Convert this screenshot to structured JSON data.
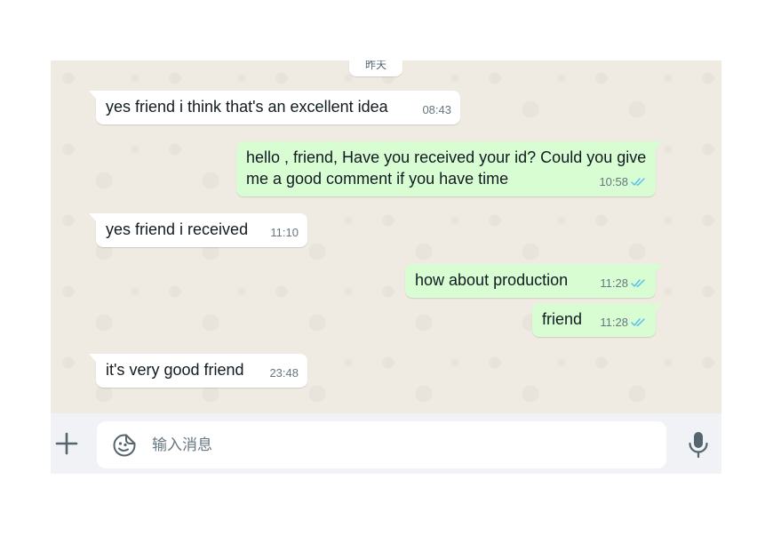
{
  "chat": {
    "date_chip_label": "昨天",
    "messages": [
      {
        "direction": "incoming",
        "text": "yes friend i think that's an excellent idea",
        "time": "08:43"
      },
      {
        "direction": "outgoing",
        "text": "hello , friend, Have you received your id? Could you give me a good comment if you have time",
        "time": "10:58",
        "status": "read"
      },
      {
        "direction": "incoming",
        "text": "yes friend i received",
        "time": "11:10"
      },
      {
        "direction": "outgoing",
        "text": "how about production",
        "time": "11:28",
        "status": "read"
      },
      {
        "direction": "outgoing",
        "text": "friend",
        "time": "11:28",
        "status": "read"
      },
      {
        "direction": "incoming",
        "text": "it's very good friend",
        "time": "23:48"
      }
    ]
  },
  "composer": {
    "placeholder": "输入消息",
    "value": "",
    "icons": {
      "attach": "plus-icon",
      "sticker": "sticker-icon",
      "voice": "microphone-icon"
    }
  },
  "colors": {
    "chat_background": "#efeae2",
    "incoming_bubble": "#ffffff",
    "outgoing_bubble": "#d9fdd3",
    "read_ticks": "#53bdeb",
    "composer_bar": "#f0f2f5"
  }
}
